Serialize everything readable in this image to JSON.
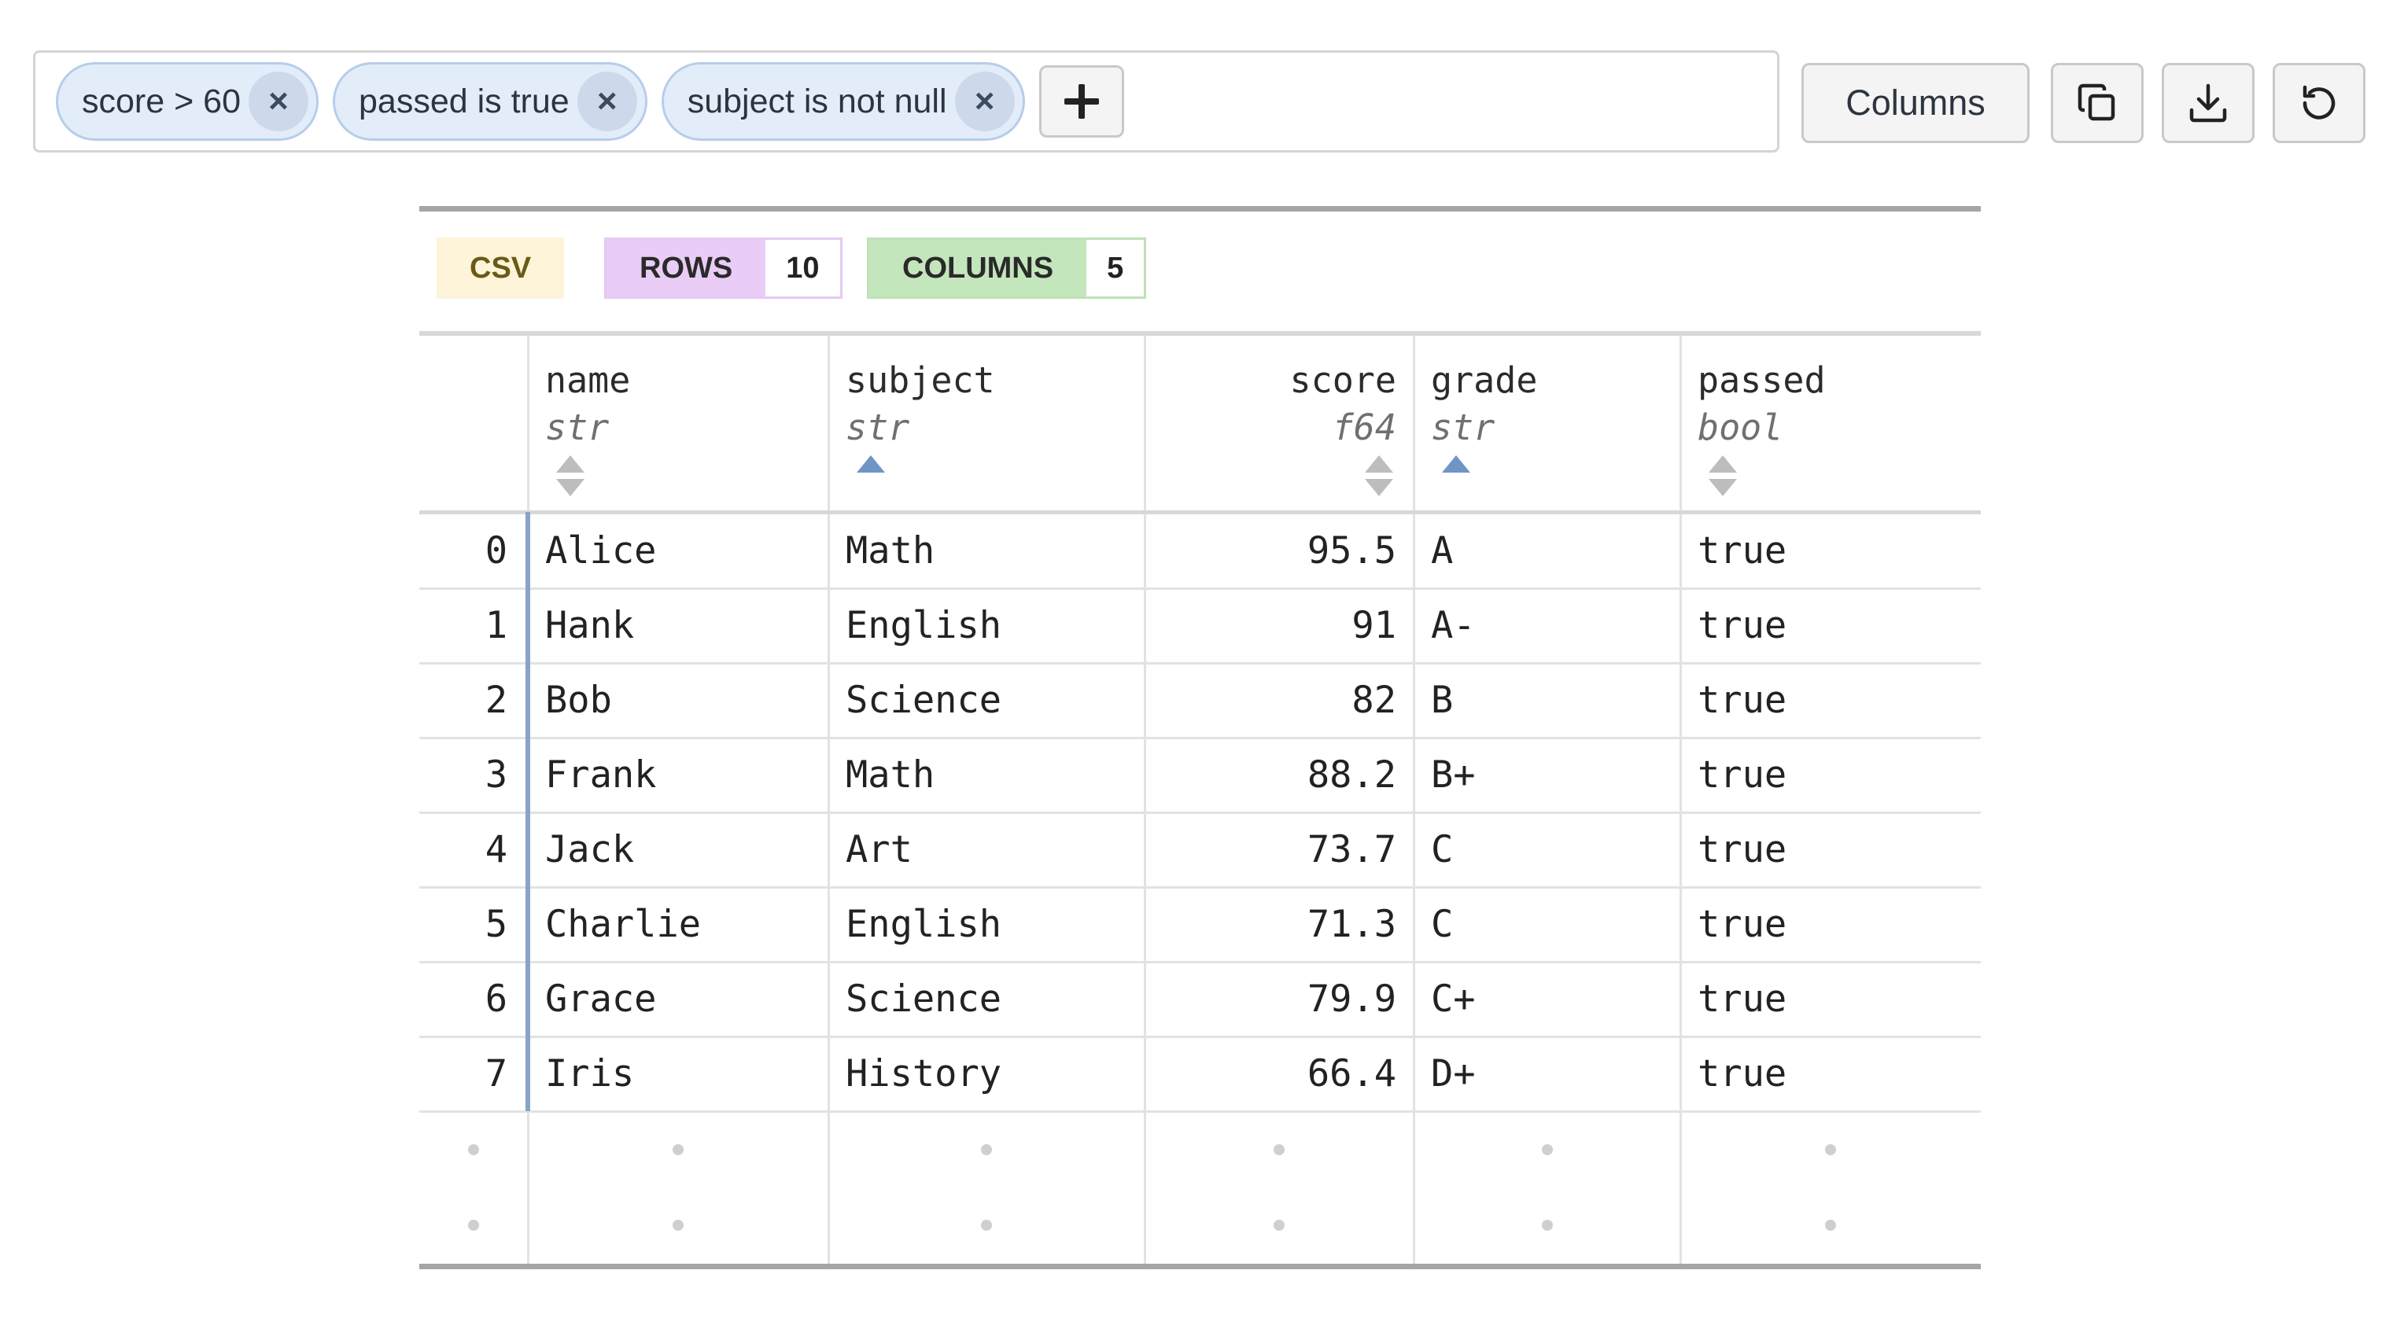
{
  "filters": [
    {
      "label": "score > 60",
      "remove": "×"
    },
    {
      "label": "passed is true",
      "remove": "×"
    },
    {
      "label": "subject is not null",
      "remove": "×"
    }
  ],
  "toolbar": {
    "columns_label": "Columns",
    "icons": [
      "plus-icon",
      "copy-icon",
      "download-icon",
      "reset-icon"
    ]
  },
  "meta": {
    "format": "CSV",
    "rows_label": "ROWS",
    "rows_value": "10",
    "columns_label": "COLUMNS",
    "columns_value": "5"
  },
  "colors": {
    "csv_bg": "#fdf4d9",
    "csv_text": "#6b5a16",
    "rows_bg": "#e9cdf6",
    "rows_border": "#e6c9f4",
    "columns_bg": "#c4e6bc",
    "columns_border": "#bfe2b7",
    "accent_sort": "#6f95c6",
    "row_index_bar": "#8aa3c6"
  },
  "table": {
    "columns": [
      {
        "name": "name",
        "type": "str",
        "sort": "none",
        "align": "left"
      },
      {
        "name": "subject",
        "type": "str",
        "sort": "asc",
        "align": "left"
      },
      {
        "name": "score",
        "type": "f64",
        "sort": "none",
        "align": "right"
      },
      {
        "name": "grade",
        "type": "str",
        "sort": "asc",
        "align": "left"
      },
      {
        "name": "passed",
        "type": "bool",
        "sort": "none",
        "align": "left"
      }
    ],
    "rows": [
      {
        "index": "0",
        "cells": [
          "Alice",
          "Math",
          "95.5",
          "A",
          "true"
        ]
      },
      {
        "index": "1",
        "cells": [
          "Hank",
          "English",
          "91",
          "A-",
          "true"
        ]
      },
      {
        "index": "2",
        "cells": [
          "Bob",
          "Science",
          "82",
          "B",
          "true"
        ]
      },
      {
        "index": "3",
        "cells": [
          "Frank",
          "Math",
          "88.2",
          "B+",
          "true"
        ]
      },
      {
        "index": "4",
        "cells": [
          "Jack",
          "Art",
          "73.7",
          "C",
          "true"
        ]
      },
      {
        "index": "5",
        "cells": [
          "Charlie",
          "English",
          "71.3",
          "C",
          "true"
        ]
      },
      {
        "index": "6",
        "cells": [
          "Grace",
          "Science",
          "79.9",
          "C+",
          "true"
        ]
      },
      {
        "index": "7",
        "cells": [
          "Iris",
          "History",
          "66.4",
          "D+",
          "true"
        ]
      }
    ],
    "truncated": true
  }
}
